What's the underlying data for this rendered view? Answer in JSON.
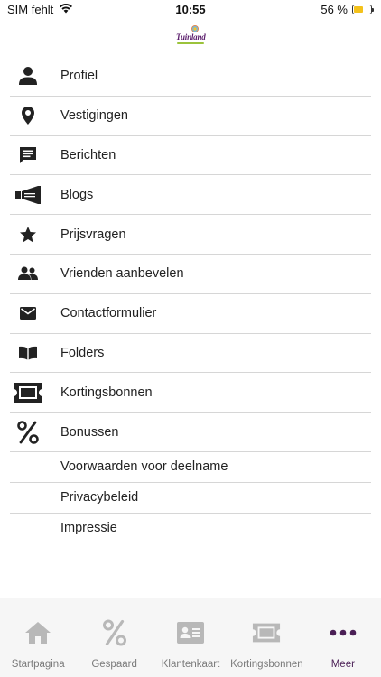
{
  "status_bar": {
    "carrier": "SIM fehlt",
    "time": "10:55",
    "battery_percent_text": "56 %",
    "battery_level": 0.56,
    "icons": [
      "wifi-icon",
      "battery-icon"
    ]
  },
  "logo": {
    "text": "Tuinland"
  },
  "menu": {
    "items": [
      {
        "label": "Profiel",
        "icon": "person-icon"
      },
      {
        "label": "Vestigingen",
        "icon": "location-pin-icon"
      },
      {
        "label": "Berichten",
        "icon": "message-icon"
      },
      {
        "label": "Blogs",
        "icon": "megaphone-icon"
      },
      {
        "label": "Prijsvragen",
        "icon": "star-icon"
      },
      {
        "label": "Vrienden aanbevelen",
        "icon": "people-icon"
      },
      {
        "label": "Contactformulier",
        "icon": "mail-icon"
      },
      {
        "label": "Folders",
        "icon": "book-icon"
      },
      {
        "label": "Kortingsbonnen",
        "icon": "ticket-icon"
      },
      {
        "label": "Bonussen",
        "icon": "percent-icon"
      }
    ],
    "text_items": [
      {
        "label": "Voorwaarden voor deelname"
      },
      {
        "label": "Privacybeleid"
      },
      {
        "label": "Impressie"
      }
    ]
  },
  "tab_bar": {
    "tabs": [
      {
        "label": "Startpagina",
        "icon": "home-icon",
        "active": false
      },
      {
        "label": "Gespaard",
        "icon": "percent-icon",
        "active": false
      },
      {
        "label": "Klantenkaart",
        "icon": "id-card-icon",
        "active": false
      },
      {
        "label": "Kortingsbonnen",
        "icon": "ticket-icon",
        "active": false
      },
      {
        "label": "Meer",
        "icon": "more-dots-icon",
        "active": true
      }
    ]
  },
  "colors": {
    "accent": "#4a1f55",
    "icon_dark": "#222222",
    "tab_inactive": "#b8b8b8",
    "divider": "#d6d6d6",
    "battery": "#f4c21b"
  }
}
